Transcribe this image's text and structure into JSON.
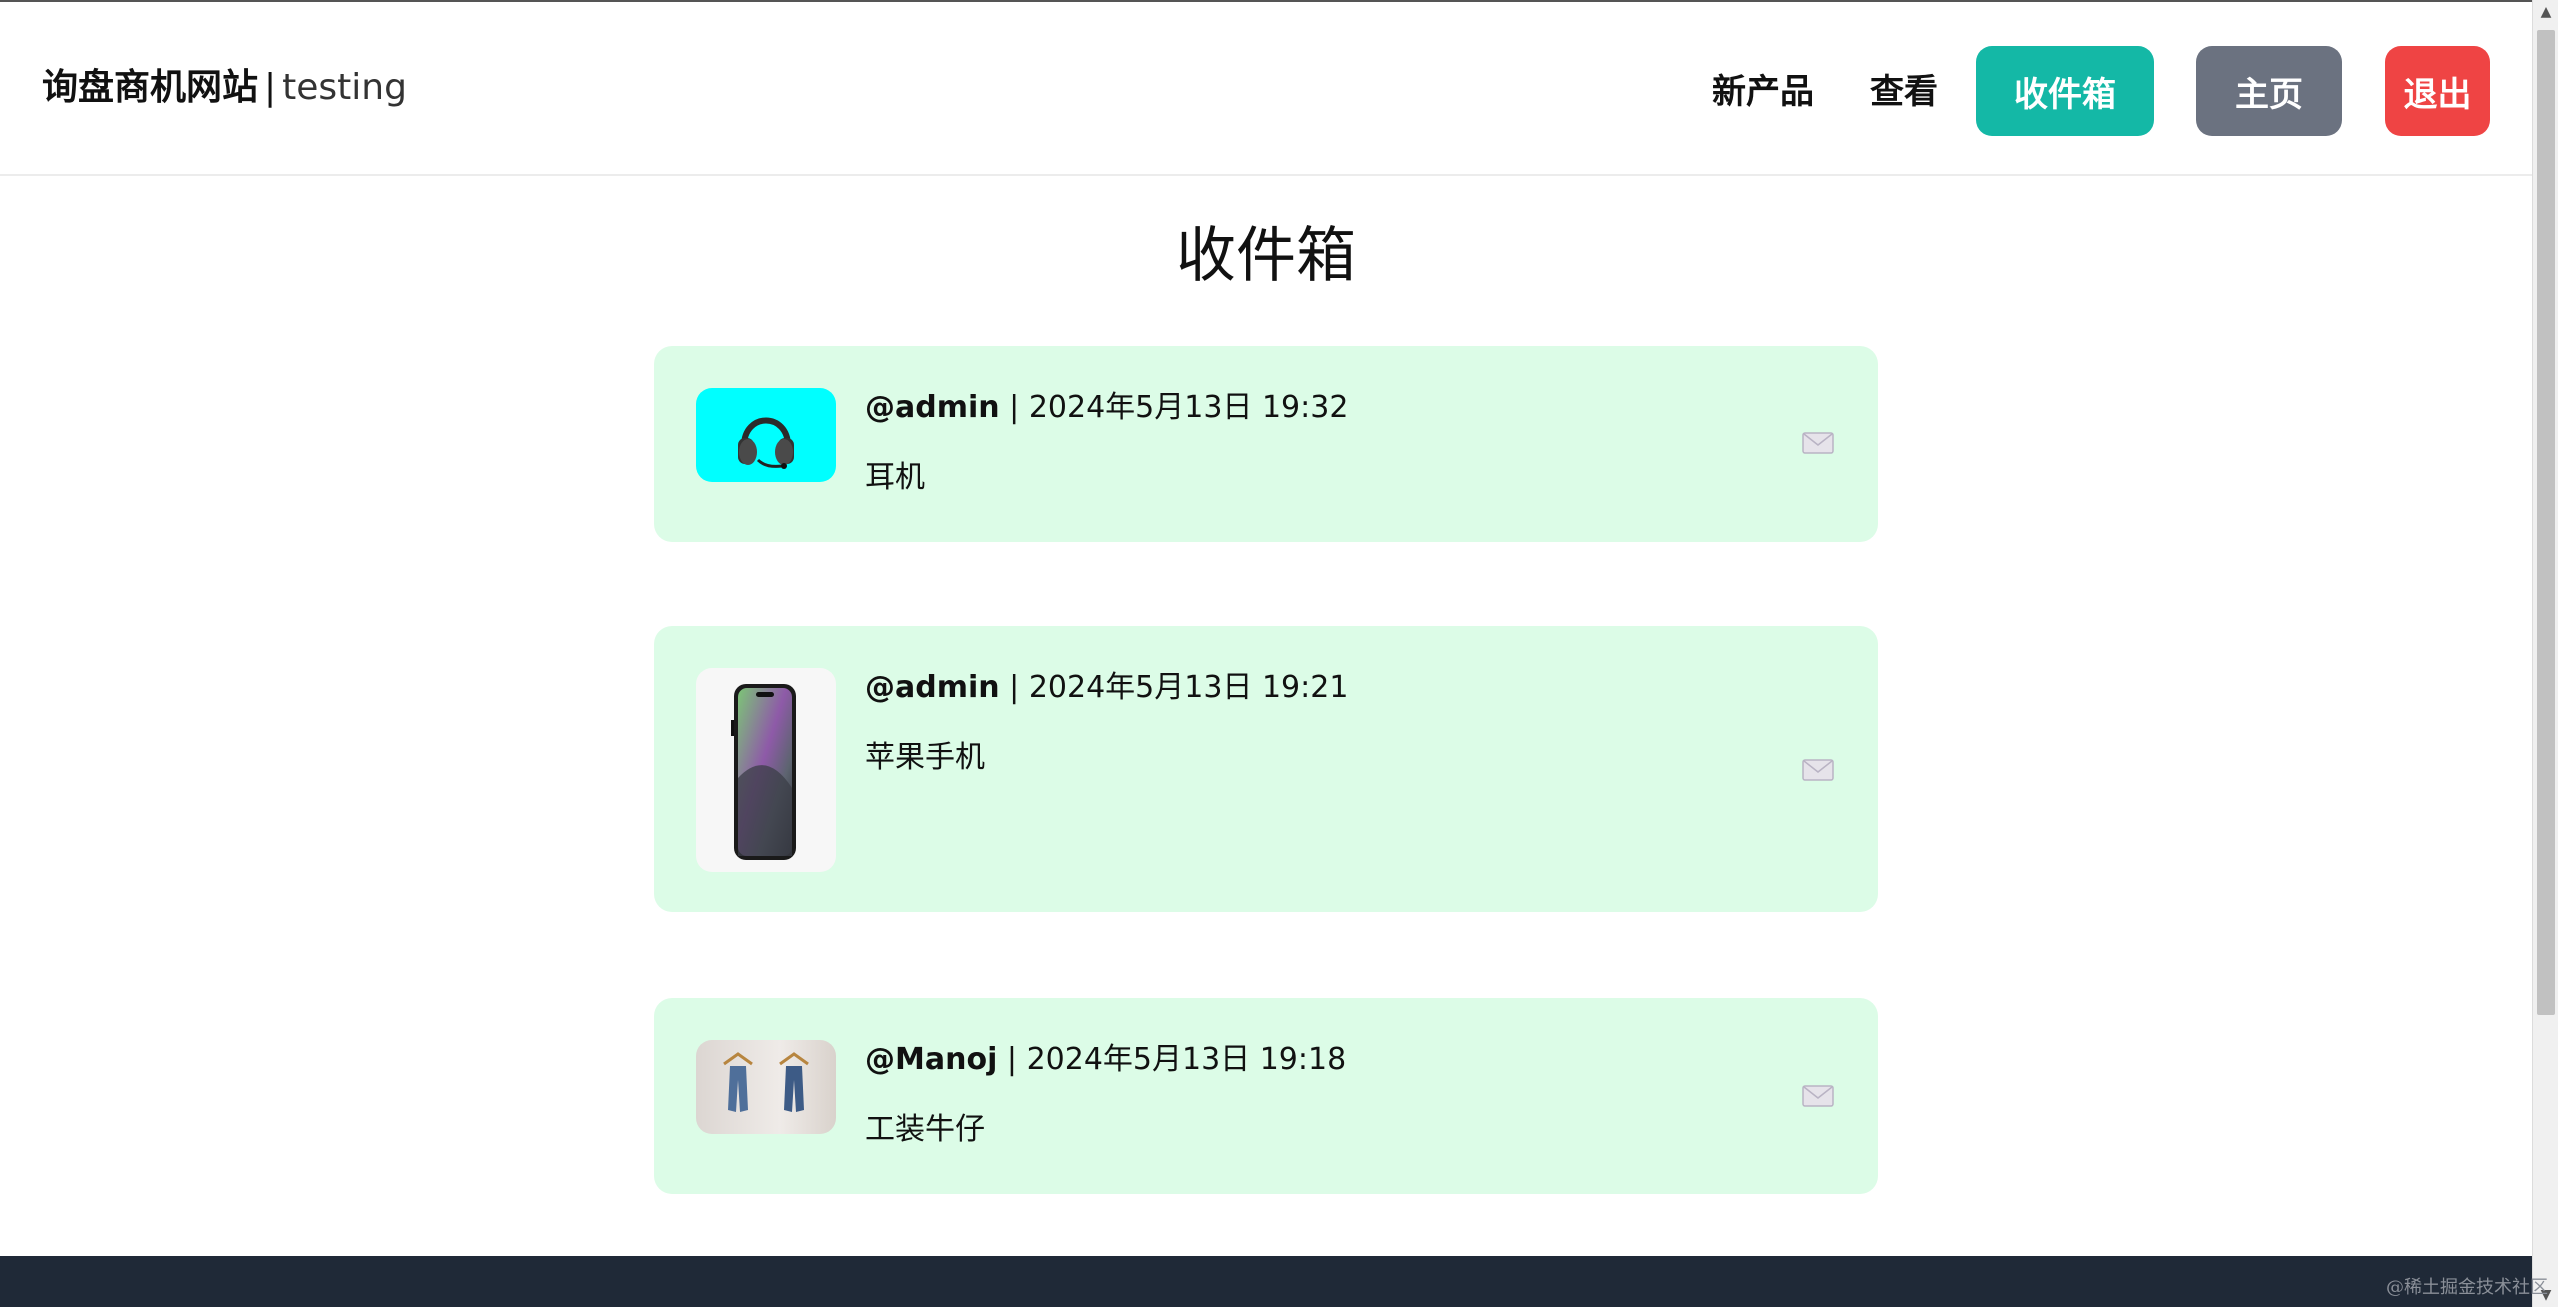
{
  "brand": {
    "name": "询盘商机网站",
    "separator": "|",
    "user": "testing"
  },
  "nav": {
    "new_products": "新产品",
    "view": "查看",
    "inbox": "收件箱",
    "home": "主页",
    "logout": "退出"
  },
  "colors": {
    "inbox_btn": "#14b8a6",
    "home_btn": "#6b7280",
    "logout_btn": "#ef4444",
    "card_bg": "#dcfce7",
    "footer_bg": "#1f2937"
  },
  "page": {
    "title": "收件箱"
  },
  "messages": [
    {
      "user": "@admin",
      "separator": "|",
      "datetime": "2024年5月13日 19:32",
      "text": "耳机",
      "image_icon": "headphones-image",
      "action_icon": "mail-icon"
    },
    {
      "user": "@admin",
      "separator": "|",
      "datetime": "2024年5月13日 19:21",
      "text": "苹果手机",
      "image_icon": "phone-image",
      "action_icon": "mail-icon"
    },
    {
      "user": "@Manoj",
      "separator": "|",
      "datetime": "2024年5月13日 19:18",
      "text": "工装牛仔",
      "image_icon": "jeans-image",
      "action_icon": "mail-icon"
    }
  ],
  "footer": {
    "watermark": "@稀土掘金技术社区"
  }
}
